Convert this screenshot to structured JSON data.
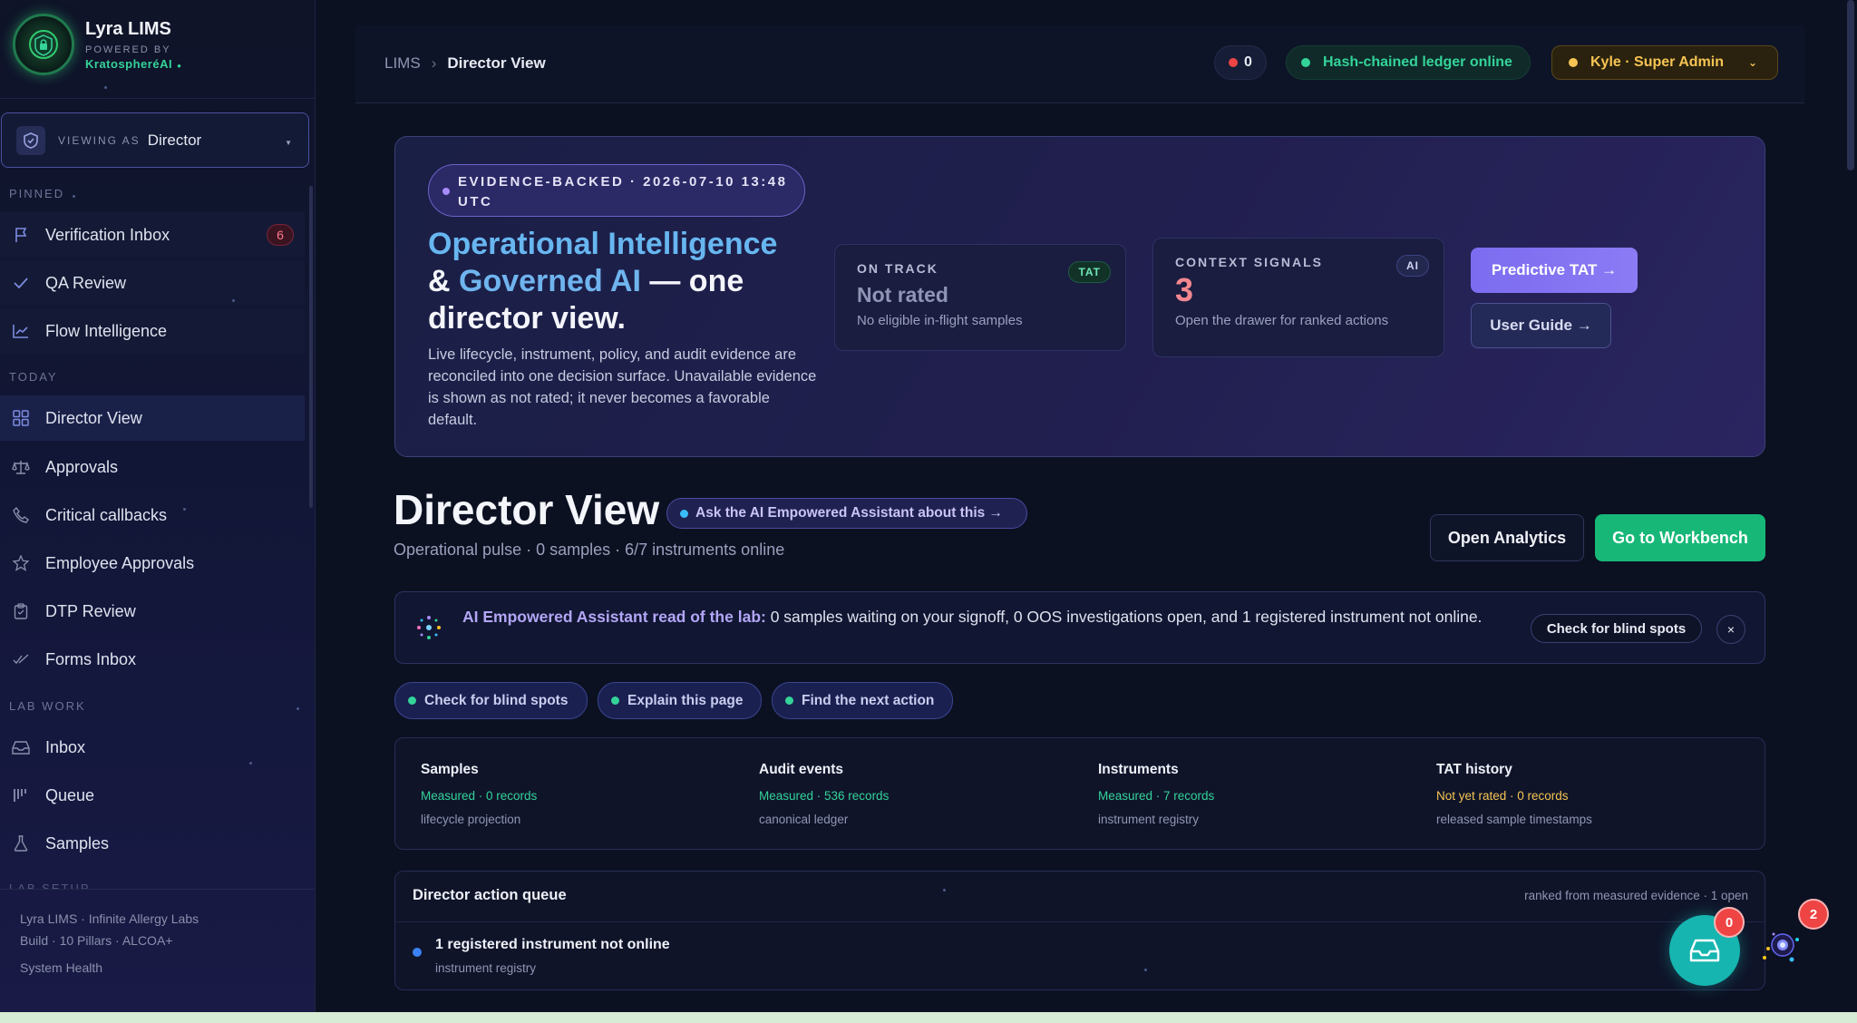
{
  "brand": {
    "title": "Lyra LIMS",
    "powered_by": "POWERED BY",
    "company": "KratospheréAI"
  },
  "viewing": {
    "label": "VIEWING AS",
    "role": "Director"
  },
  "sidebar": {
    "sections": {
      "pinned": "PINNED",
      "today": "TODAY",
      "lab_work": "LAB WORK",
      "lab_setup": "LAB SETUP"
    },
    "pinned": [
      {
        "label": "Verification Inbox",
        "icon": "flag-icon",
        "badge": "6"
      },
      {
        "label": "QA Review",
        "icon": "check-icon"
      },
      {
        "label": "Flow Intelligence",
        "icon": "trend-icon"
      }
    ],
    "today": [
      {
        "label": "Director View",
        "icon": "grid-icon",
        "active": true
      },
      {
        "label": "Approvals",
        "icon": "scale-icon"
      },
      {
        "label": "Critical callbacks",
        "icon": "phone-icon"
      },
      {
        "label": "Employee Approvals",
        "icon": "star-icon"
      },
      {
        "label": "DTP Review",
        "icon": "clipboard-icon"
      },
      {
        "label": "Forms Inbox",
        "icon": "double-check-icon"
      }
    ],
    "lab_work": [
      {
        "label": "Inbox",
        "icon": "inbox-icon"
      },
      {
        "label": "Queue",
        "icon": "queue-icon"
      },
      {
        "label": "Samples",
        "icon": "flask-icon"
      }
    ],
    "footer": {
      "line1": "Lyra LIMS · Infinite Allergy Labs",
      "line2": "Build · 10 Pillars · ALCOA+",
      "health": "System Health"
    }
  },
  "topbar": {
    "breadcrumb_root": "LIMS",
    "breadcrumb_sep": "›",
    "breadcrumb_current": "Director View",
    "alert_count": "0",
    "ledger_status": "Hash-chained ledger online",
    "user": "Kyle · Super Admin"
  },
  "hero": {
    "chip": "EVIDENCE-BACKED · 2026-07-10 13:48 UTC",
    "title_a": "Operational Intelligence",
    "title_b": "& ",
    "title_c": "Governed AI",
    "title_d": " — one director view.",
    "description": "Live lifecycle, instrument, policy, and audit evidence are reconciled into one decision surface. Unavailable evidence is shown as not rated; it never becomes a favorable default.",
    "on_track": {
      "label": "ON TRACK",
      "tag": "TAT",
      "value": "Not rated",
      "sub": "No eligible in-flight samples"
    },
    "context": {
      "label": "CONTEXT SIGNALS",
      "tag": "AI",
      "value": "3",
      "sub": "Open the drawer for ranked actions"
    },
    "predict_button": "Predictive TAT →",
    "guide_button": "User Guide →"
  },
  "page": {
    "title": "Director View",
    "ask_chip": "Ask the AI Empowered Assistant about this →",
    "pulse": "Operational pulse · 0 samples · 6/7 instruments online",
    "analytics_button": "Open Analytics",
    "workbench_button": "Go to Workbench"
  },
  "assistant": {
    "lead": "AI Empowered Assistant read of the lab:",
    "text": " 0 samples waiting on your signoff, 0 OOS investigations open, and 1 registered instrument not online.",
    "blind_button": "Check for blind spots",
    "close": "×"
  },
  "quick_actions": [
    "Check for blind spots",
    "Explain this page",
    "Find the next action"
  ],
  "evidence": [
    {
      "title": "Samples",
      "status": "Measured · 0 records",
      "state": "ok",
      "source": "lifecycle projection"
    },
    {
      "title": "Audit events",
      "status": "Measured · 536 records",
      "state": "ok",
      "source": "canonical ledger"
    },
    {
      "title": "Instruments",
      "status": "Measured · 7 records",
      "state": "ok",
      "source": "instrument registry"
    },
    {
      "title": "TAT history",
      "status": "Not yet rated · 0 records",
      "state": "warn",
      "source": "released sample timestamps"
    }
  ],
  "queue": {
    "title": "Director action queue",
    "meta": "ranked from measured evidence · 1 open",
    "rows": [
      {
        "title": "1 registered instrument not online",
        "sub": "instrument registry"
      }
    ]
  },
  "fab": {
    "inbox_badge": "0",
    "orb_badge": "2"
  },
  "colors": {
    "background": "#0c1122",
    "accent_green": "#17b877",
    "accent_purple": "#7c6cf0",
    "warning": "#f6c453",
    "danger": "#ef4444"
  }
}
